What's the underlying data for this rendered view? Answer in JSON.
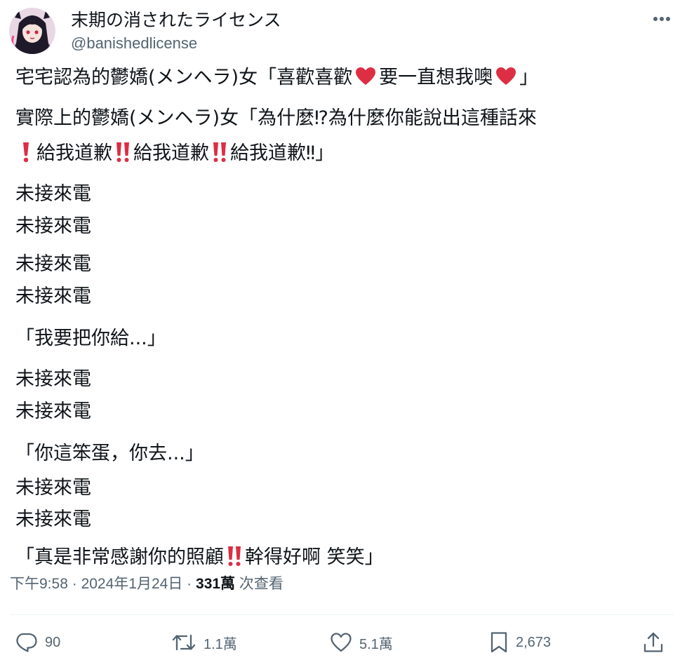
{
  "author": {
    "display_name": "末期の消されたライセンス",
    "handle": "@banishedlicense",
    "avatar_icon": "anime-girl-avatar"
  },
  "tweet": {
    "lines": [
      {
        "parts": [
          "宅宅認為的鬱嬌(メンヘラ)女「喜歡喜歡",
          "要一直想我噢",
          "」"
        ]
      },
      {
        "parts": [
          "實際上的鬱嬌(メンヘラ)女「為什麼⁉為什麼你能說出這種話來"
        ]
      },
      {
        "parts": [
          "給我道歉",
          "給我道歉",
          "給我道歉‼」"
        ]
      },
      {
        "text": "未接來電"
      },
      {
        "text": "未接來電"
      },
      {
        "text": "未接來電"
      },
      {
        "text": "未接來電"
      },
      {
        "text": "「我要把你給...」"
      },
      {
        "text": "未接來電"
      },
      {
        "text": "未接來電"
      },
      {
        "text": "「你這笨蛋，你去...」"
      },
      {
        "text": "未接來電"
      },
      {
        "text": "未接來電"
      },
      {
        "parts": [
          "「真是非常感謝你的照顧",
          "幹得好啊 笑笑」"
        ]
      }
    ],
    "emoji": {
      "heart": "red-heart-emoji",
      "exclamation": "red-exclamation-emoji",
      "double_exclamation": "red-double-exclamation-emoji"
    }
  },
  "meta": {
    "time": "下午9:58",
    "sep1": "·",
    "date": "2024年1月24日",
    "sep2": "·",
    "views_count": "331萬",
    "views_label": "次查看"
  },
  "actions": {
    "reply": {
      "icon": "reply-icon",
      "count": "90"
    },
    "retweet": {
      "icon": "retweet-icon",
      "count": "1.1萬"
    },
    "like": {
      "icon": "heart-icon",
      "count": "5.1萬"
    },
    "bookmark": {
      "icon": "bookmark-icon",
      "count": "2,673"
    },
    "share": {
      "icon": "share-icon"
    }
  },
  "colors": {
    "text": "#0f1419",
    "secondary": "#536471",
    "emoji_red": "#dd2e44",
    "divider": "#eff3f4"
  }
}
